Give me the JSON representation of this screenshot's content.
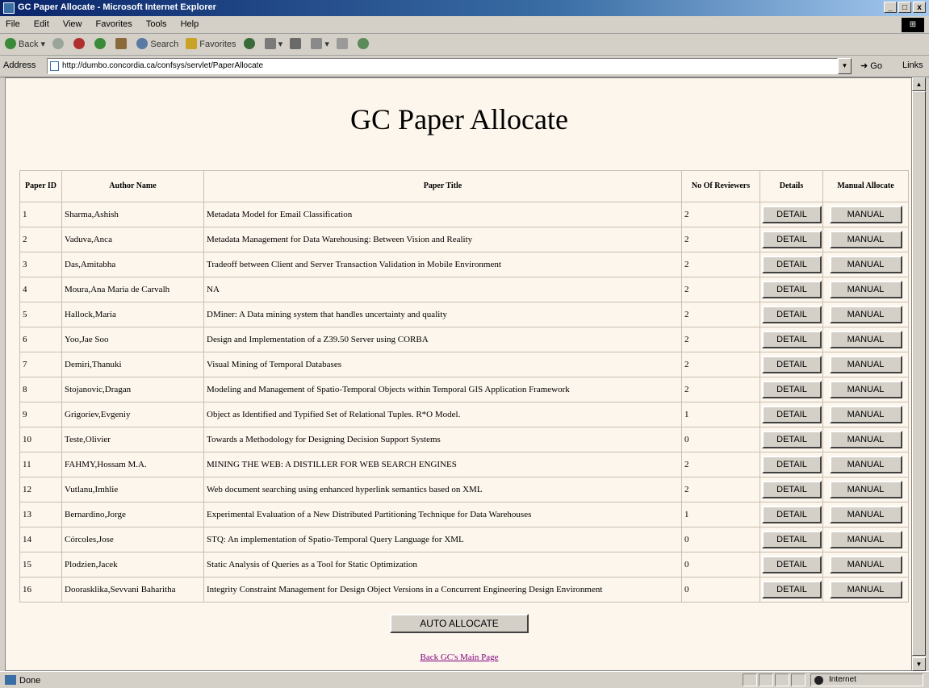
{
  "window": {
    "title": "GC Paper Allocate - Microsoft Internet Explorer",
    "controls": [
      "_",
      "□",
      "x"
    ]
  },
  "menu": {
    "items": [
      "File",
      "Edit",
      "View",
      "Favorites",
      "Tools",
      "Help"
    ],
    "logo": "⊞"
  },
  "toolbar": {
    "back_label": "Back",
    "search_label": "Search",
    "favorites_label": "Favorites"
  },
  "address": {
    "label": "Address",
    "url": "http://dumbo.concordia.ca/confsys/servlet/PaperAllocate",
    "go_label": "Go",
    "links_label": "Links"
  },
  "page": {
    "title": "GC Paper Allocate",
    "columns": {
      "paper_id": "Paper ID",
      "author": "Author Name",
      "title": "Paper Title",
      "reviewers": "No Of Reviewers",
      "details": "Details",
      "manual": "Manual Allocate"
    },
    "detail_label": "DETAIL",
    "manual_label": "MANUAL",
    "rows": [
      {
        "id": "1",
        "author": "Sharma,Ashish",
        "title": "Metadata Model for Email Classification",
        "reviewers": "2"
      },
      {
        "id": "2",
        "author": "Vaduva,Anca",
        "title": "Metadata Management for Data Warehousing: Between Vision and Reality",
        "reviewers": "2"
      },
      {
        "id": "3",
        "author": "Das,Amitabha",
        "title": "Tradeoff between Client and Server Transaction Validation in Mobile Environment",
        "reviewers": "2"
      },
      {
        "id": "4",
        "author": "Moura,Ana Maria de Carvalh",
        "title": "NA",
        "reviewers": "2"
      },
      {
        "id": "5",
        "author": "Hallock,Maria",
        "title": "DMiner: A Data mining system that handles uncertainty and quality",
        "reviewers": "2"
      },
      {
        "id": "6",
        "author": "Yoo,Jae Soo",
        "title": "Design and Implementation of a Z39.50 Server using CORBA",
        "reviewers": "2"
      },
      {
        "id": "7",
        "author": "Demiri,Thanuki",
        "title": "Visual Mining of Temporal Databases",
        "reviewers": "2"
      },
      {
        "id": "8",
        "author": "Stojanovic,Dragan",
        "title": "Modeling and Management of Spatio-Temporal Objects within Temporal GIS Application Framework",
        "reviewers": "2"
      },
      {
        "id": "9",
        "author": "Grigoriev,Evgeniy",
        "title": "Object as Identified and Typified Set of Relational Tuples. R*O Model.",
        "reviewers": "1"
      },
      {
        "id": "10",
        "author": "Teste,Olivier",
        "title": "Towards a Methodology for Designing Decision Support Systems",
        "reviewers": "0"
      },
      {
        "id": "11",
        "author": "FAHMY,Hossam M.A.",
        "title": "MINING THE WEB: A DISTILLER FOR WEB SEARCH ENGINES",
        "reviewers": "2"
      },
      {
        "id": "12",
        "author": "Vutlanu,Imhlie",
        "title": "Web document searching using enhanced hyperlink semantics based on XML",
        "reviewers": "2"
      },
      {
        "id": "13",
        "author": "Bernardino,Jorge",
        "title": "Experimental Evaluation of a New Distributed Partitioning Technique for Data Warehouses",
        "reviewers": "1"
      },
      {
        "id": "14",
        "author": "Córcoles,Jose",
        "title": "STQ: An implementation of Spatio-Temporal Query Language for XML",
        "reviewers": "0"
      },
      {
        "id": "15",
        "author": "Plodzien,Jacek",
        "title": "Static Analysis of Queries as a Tool for Static Optimization",
        "reviewers": "0"
      },
      {
        "id": "16",
        "author": "Doorasklika,Sevvani Baharitha",
        "title": "Integrity Constraint Management for Design Object Versions in a Concurrent Engineering Design Environment",
        "reviewers": "0"
      }
    ],
    "auto_allocate_label": "AUTO ALLOCATE",
    "back_link": "Back GC's Main Page"
  },
  "status": {
    "text": "Done",
    "zone": "Internet"
  }
}
